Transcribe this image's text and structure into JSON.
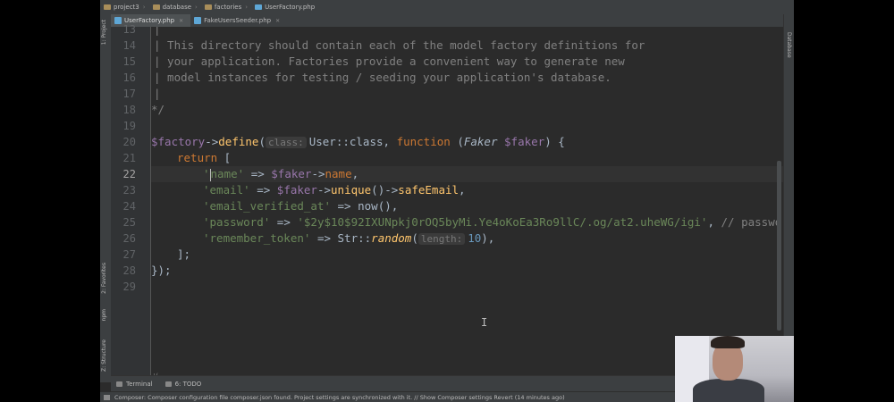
{
  "breadcrumb": [
    {
      "label": "project3"
    },
    {
      "label": "database"
    },
    {
      "label": "factories"
    },
    {
      "label": "UserFactory.php"
    }
  ],
  "tabs": [
    {
      "label": "UserFactory.php",
      "active": true,
      "icon_color": "#5ea7d6"
    },
    {
      "label": "FakeUsersSeeder.php",
      "active": false,
      "icon_color": "#5ea7d6"
    }
  ],
  "tool_windows": {
    "left": [
      "1: Project",
      "2: Favorites",
      "npm",
      "Z: Structure"
    ],
    "right": [
      "Database"
    ],
    "bottom": [
      "Terminal",
      "6: TODO"
    ]
  },
  "editor": {
    "current_line": 22,
    "line_numbers": [
      "13",
      "14",
      "15",
      "16",
      "17",
      "18",
      "19",
      "20",
      "21",
      "22",
      "23",
      "24",
      "25",
      "26",
      "27",
      "28",
      "29"
    ],
    "lines": [
      {
        "n": "13",
        "text": "|"
      },
      {
        "n": "14",
        "text": "| This directory should contain each of the model factory definitions for"
      },
      {
        "n": "15",
        "text": "| your application. Factories provide a convenient way to generate new"
      },
      {
        "n": "16",
        "text": "| model instances for testing / seeding your application's database."
      },
      {
        "n": "17",
        "text": "|"
      },
      {
        "n": "18",
        "text": "*/"
      },
      {
        "n": "19",
        "text": ""
      },
      {
        "n": "20",
        "tokens": {
          "var": "$factory",
          "arrow": "->",
          "fn": "define",
          "open": "(",
          "hint": "class:",
          "cls": "User::class",
          "comma": ", ",
          "kw": "function",
          "sp": " (",
          "type": "Faker",
          "param": " $faker",
          "close": ") {"
        }
      },
      {
        "n": "21",
        "tokens": {
          "kw": "return",
          "rest": " ["
        }
      },
      {
        "n": "22",
        "tokens": {
          "q": "'",
          "key": "name'",
          "arrow": " => ",
          "var": "$faker",
          "op": "->",
          "prop": "name",
          "end": ","
        }
      },
      {
        "n": "23",
        "tokens": {
          "key": "'email'",
          "arrow": " => ",
          "var": "$faker",
          "op": "->",
          "fn1": "unique",
          "p1": "()",
          "op2": "->",
          "fn2": "safeEmail",
          "end": ","
        }
      },
      {
        "n": "24",
        "tokens": {
          "key": "'email_verified_at'",
          "arrow": " => ",
          "fn": "now",
          "end": "(),"
        }
      },
      {
        "n": "25",
        "tokens": {
          "key": "'password'",
          "arrow": " => ",
          "str": "'$2y$10$92IXUNpkj0rOQ5byMi.Ye4oKoEa3Ro9llC/.og/at2.uheWG/igi'",
          "comma": ", ",
          "cm": "// password"
        }
      },
      {
        "n": "26",
        "tokens": {
          "key": "'remember_token'",
          "arrow": " => ",
          "cls": "Str::",
          "fn": "random",
          "open": "(",
          "hint": "length:",
          "num": "10",
          "end": "),"
        }
      },
      {
        "n": "27",
        "text": "];"
      },
      {
        "n": "28",
        "text": "});"
      },
      {
        "n": "29",
        "text": ""
      }
    ]
  },
  "scope_indicator": "\\(",
  "status_bar": {
    "message": "Composer: Composer configuration file composer.json found. Project settings are synchronized with it. // Show Composer settings   Revert (14 minutes ago)"
  },
  "colors": {
    "editor_bg": "#2b2b2b",
    "keyword": "#cc7832",
    "string": "#6a8759",
    "variable": "#9876aa",
    "function": "#ffc66d",
    "comment": "#808080"
  }
}
